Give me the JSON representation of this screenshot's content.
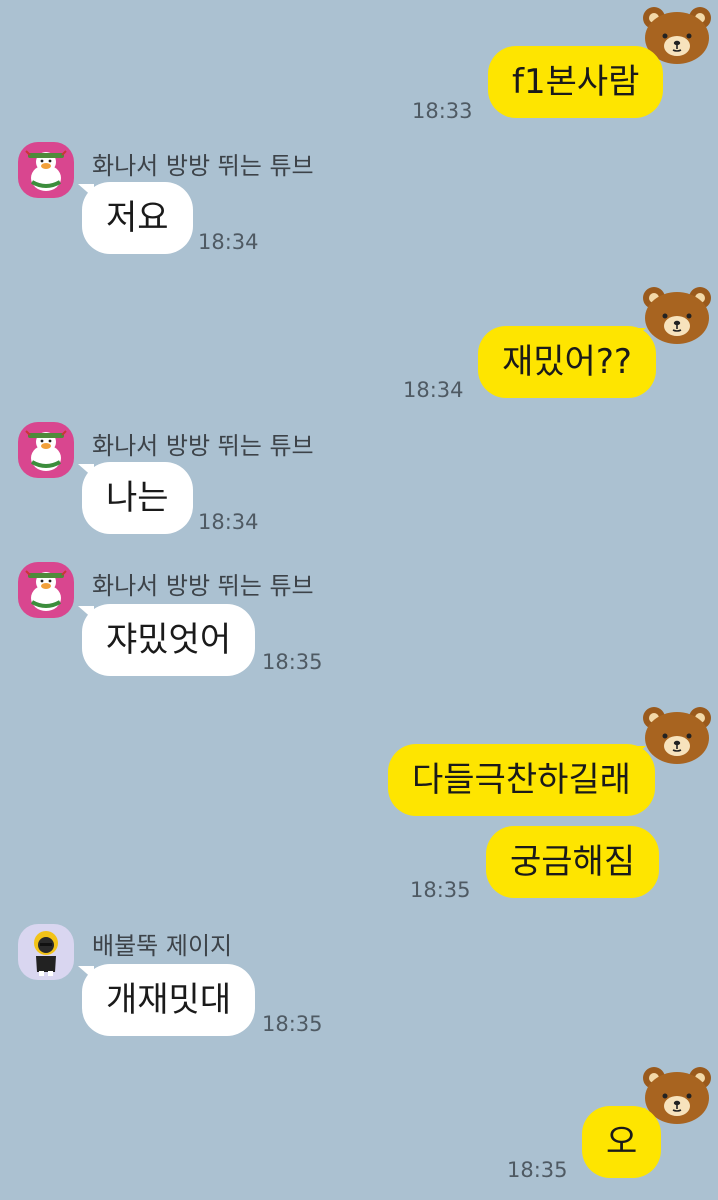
{
  "messages": {
    "m1": {
      "text": "f1본사람",
      "time": "18:33"
    },
    "m2": {
      "sender": "화나서 방방 뛰는 튜브",
      "text": "저요",
      "time": "18:34"
    },
    "m3": {
      "text": "재밌어??",
      "time": "18:34"
    },
    "m4": {
      "sender": "화나서 방방 뛰는 튜브",
      "text": "나는",
      "time": "18:34"
    },
    "m5": {
      "sender": "화나서 방방 뛰는 튜브",
      "text": "쟈밌엇어",
      "time": "18:35"
    },
    "m6": {
      "text1": "다들극찬하길래",
      "text2": "궁금해짐",
      "time": "18:35"
    },
    "m7": {
      "sender": "배불뚝 제이지",
      "text": "개재밋대",
      "time": "18:35"
    },
    "m8": {
      "text": "오",
      "time": "18:35"
    }
  },
  "colors": {
    "background": "#abc1d1",
    "outgoing_bubble": "#fee500",
    "incoming_bubble": "#ffffff"
  },
  "icons": {
    "self_avatar": "bear-sticker-icon",
    "tube_avatar": "tube-duck-avatar",
    "jayg_avatar": "jayg-avatar"
  }
}
